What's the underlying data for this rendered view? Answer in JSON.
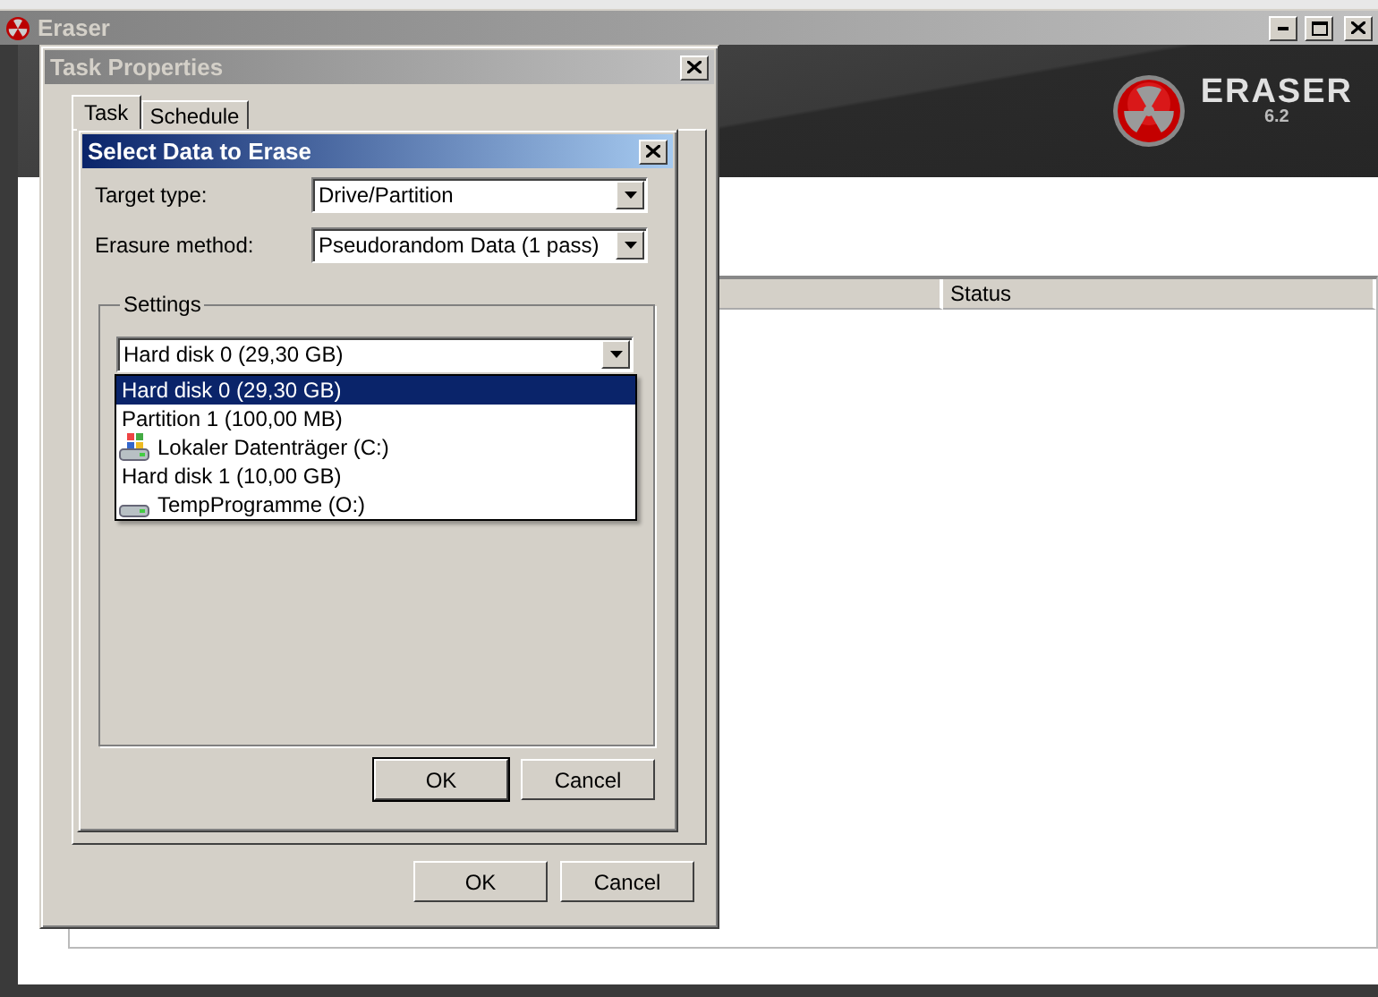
{
  "main_window": {
    "title": "Eraser",
    "brand": {
      "name": "ERASER",
      "version": "6.2"
    },
    "table": {
      "columns": [
        "Status"
      ]
    }
  },
  "task_properties": {
    "title": "Task Properties",
    "tabs": [
      {
        "label": "Task",
        "selected": true
      },
      {
        "label": "Schedule",
        "selected": false
      }
    ],
    "buttons": [
      {
        "label": "OK",
        "default": false
      },
      {
        "label": "Cancel",
        "default": false
      }
    ]
  },
  "select_dialog": {
    "title": "Select Data to Erase",
    "fields": [
      {
        "label": "Target type:",
        "value": "Drive/Partition"
      },
      {
        "label": "Erasure method:",
        "value": "Pseudorandom Data (1 pass)"
      }
    ],
    "settings": {
      "title": "Settings",
      "combo": {
        "value": "Hard disk 0 (29,30 GB)",
        "expanded": true
      },
      "options": [
        {
          "label": "Hard disk 0 (29,30 GB)",
          "kind": "disk",
          "selected": true
        },
        {
          "label": "Partition 1 (100,00 MB)",
          "kind": "partition",
          "selected": false
        },
        {
          "label": "Lokaler Datenträger (C:)",
          "kind": "system-volume",
          "selected": false
        },
        {
          "label": "Hard disk 1 (10,00 GB)",
          "kind": "disk",
          "selected": false
        },
        {
          "label": "TempProgramme (O:)",
          "kind": "volume",
          "selected": false
        }
      ]
    },
    "buttons": [
      {
        "label": "OK",
        "default": true
      },
      {
        "label": "Cancel",
        "default": false
      }
    ]
  }
}
